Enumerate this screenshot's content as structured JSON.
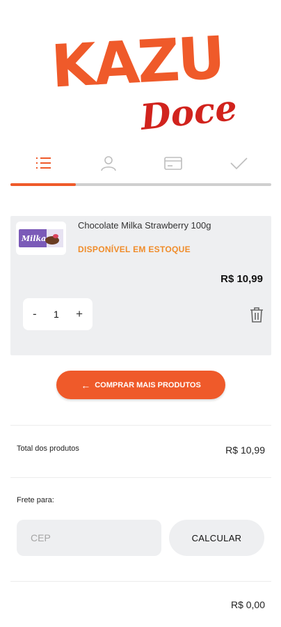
{
  "brand": {
    "name_line1": "KAZU",
    "name_line2": "Doces",
    "primary_color": "#ef5a2a",
    "secondary_color": "#d1231d"
  },
  "steps": {
    "items": [
      {
        "name": "cart",
        "icon": "list-icon",
        "active": true
      },
      {
        "name": "account",
        "icon": "person-icon",
        "active": false
      },
      {
        "name": "payment",
        "icon": "credit-card-icon",
        "active": false
      },
      {
        "name": "confirmation",
        "icon": "checkmark-icon",
        "active": false
      }
    ],
    "progress": 0.25
  },
  "cart": {
    "items": [
      {
        "name": "Chocolate Milka Strawberry 100g",
        "stock": "DISPONÍVEL EM ESTOQUE",
        "price": "R$ 10,99",
        "quantity": "1",
        "minus": "-",
        "plus": "+",
        "thumb_text": "Milka"
      }
    ]
  },
  "actions": {
    "more_products": "COMPRAR MAIS PRODUTOS",
    "more_products_icon": "←"
  },
  "summary": {
    "total_label": "Total dos produtos",
    "total_value": "R$ 10,99",
    "frete_label": "Frete para:",
    "cep_placeholder": "CEP",
    "calc_label": "CALCULAR",
    "frete_value": "R$ 0,00"
  },
  "colors": {
    "stock": "#f08c2a",
    "card_bg": "#eeeff1",
    "inactive_icon": "#bdbdbd"
  }
}
